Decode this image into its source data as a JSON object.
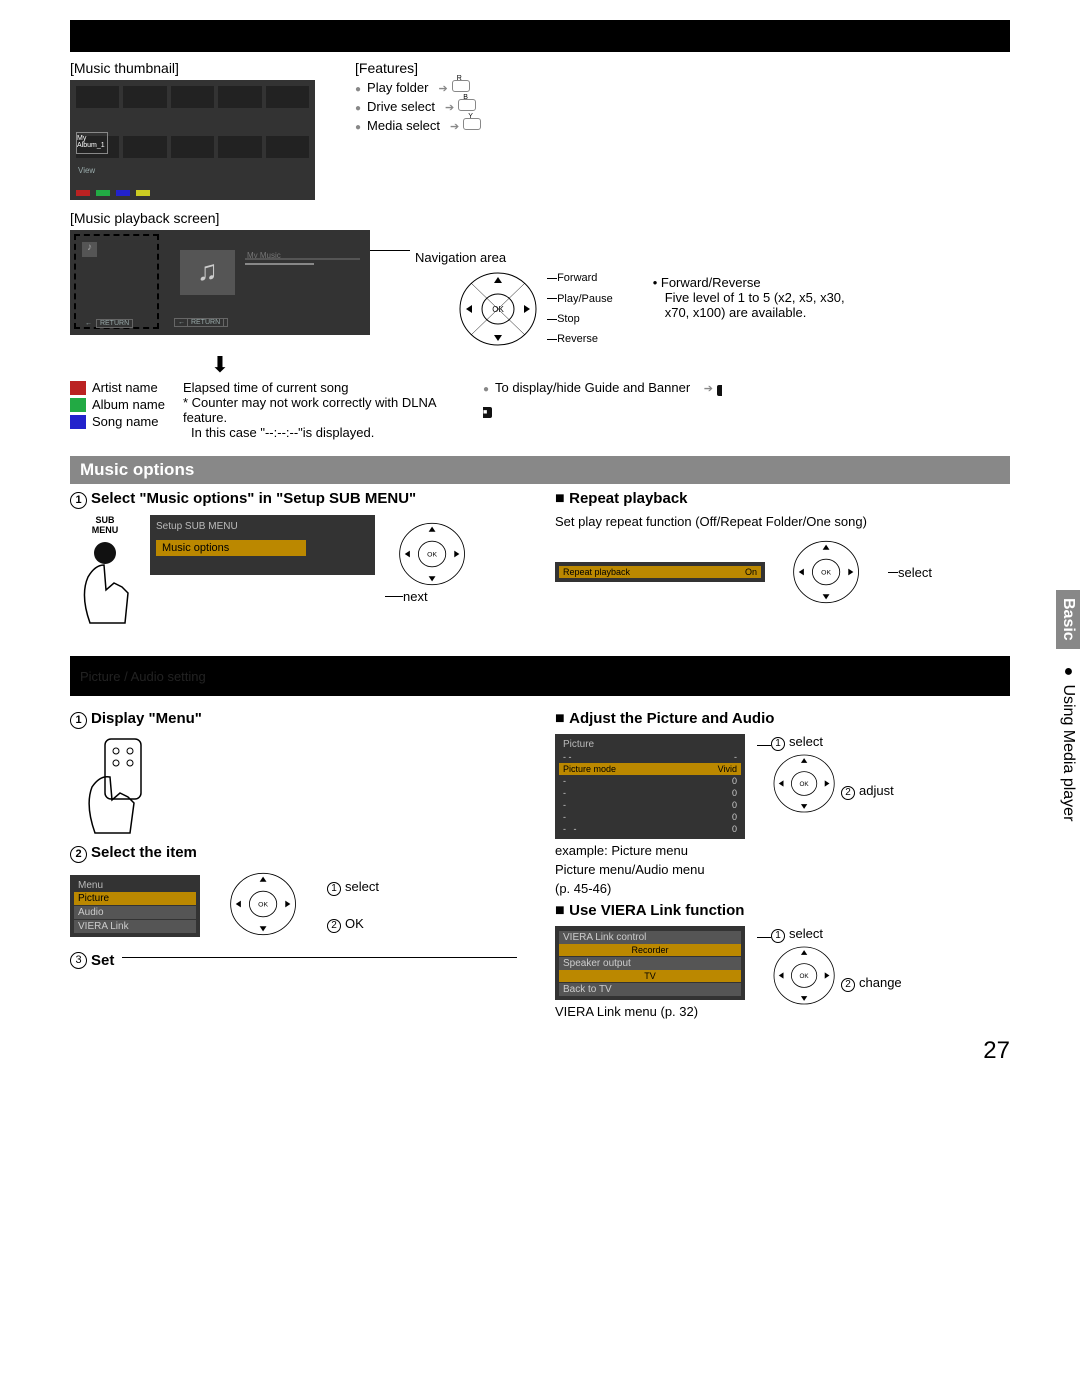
{
  "page_number": "27",
  "top_labels": {
    "thumb": "[Music thumbnail]",
    "features": "[Features]",
    "playback": "[Music playback screen]"
  },
  "features": {
    "play_folder": "Play folder",
    "drive_select": "Drive select",
    "media_select": "Media select",
    "key_r": "R",
    "key_b": "B",
    "key_y": "Y"
  },
  "thumb": {
    "album": "My Album_1",
    "view": "View"
  },
  "playback": {
    "my_music": "My Music",
    "return": "RETURN"
  },
  "nav_area_label": "Navigation area",
  "dpad_labels": {
    "forward": "Forward",
    "play_pause": "Play/Pause",
    "stop": "Stop",
    "reverse": "Reverse",
    "ok": "OK"
  },
  "fr_note": {
    "l1": "• Forward/Reverse",
    "l2": "Five level of 1 to 5 (x2, x5, x30,",
    "l3": "x70, x100) are available."
  },
  "info_left": {
    "artist": "Artist name",
    "album": "Album name",
    "song": "Song name"
  },
  "elapsed": {
    "l1": "Elapsed time of current song",
    "l2": "* Counter may not work correctly with DLNA feature.",
    "l3": "In this case \"--:--:--\"is displayed."
  },
  "guide_banner": {
    "text": "To display/hide Guide and Banner",
    "info": "INFO"
  },
  "music_options_header": "Music options",
  "step1": {
    "title": "Select \"Music options\" in \"Setup SUB MENU\"",
    "sub": "SUB\nMENU",
    "box_title": "Setup SUB MENU",
    "box_item": "Music options",
    "next": "next"
  },
  "repeat": {
    "title": "Repeat playback",
    "desc": "Set play repeat function (Off/Repeat Folder/One song)",
    "box_label": "Repeat playback",
    "box_value": "On",
    "select": "select"
  },
  "dark_bar2_left": "Picture / Audio setting",
  "dark_bar2_right": "",
  "display_menu": {
    "title": "Display \"Menu\"",
    "select_item": "Select the item",
    "select": "select",
    "ok": "OK",
    "menu_title": "Menu",
    "picture": "Picture",
    "audio": "Audio",
    "viera": "VIERA Link",
    "set_label": "Set"
  },
  "adjust": {
    "title": "Adjust the Picture and Audio",
    "menu_title": "Picture",
    "row_label": "Picture mode",
    "row_value": "Vivid",
    "zero": "0",
    "example": "example: Picture menu",
    "pm_note": "Picture menu/Audio menu",
    "pages": "(p. 45-46)",
    "select": "select",
    "adjust": "adjust"
  },
  "viera": {
    "title": "Use VIERA Link function",
    "control": "VIERA Link control",
    "recorder": "Recorder",
    "speaker": "Speaker output",
    "tv": "TV",
    "back": "Back to TV",
    "note": "VIERA Link menu (p. 32)",
    "select": "select",
    "change": "change"
  },
  "side": {
    "basic": "Basic",
    "rest": "●  Using Media player"
  }
}
